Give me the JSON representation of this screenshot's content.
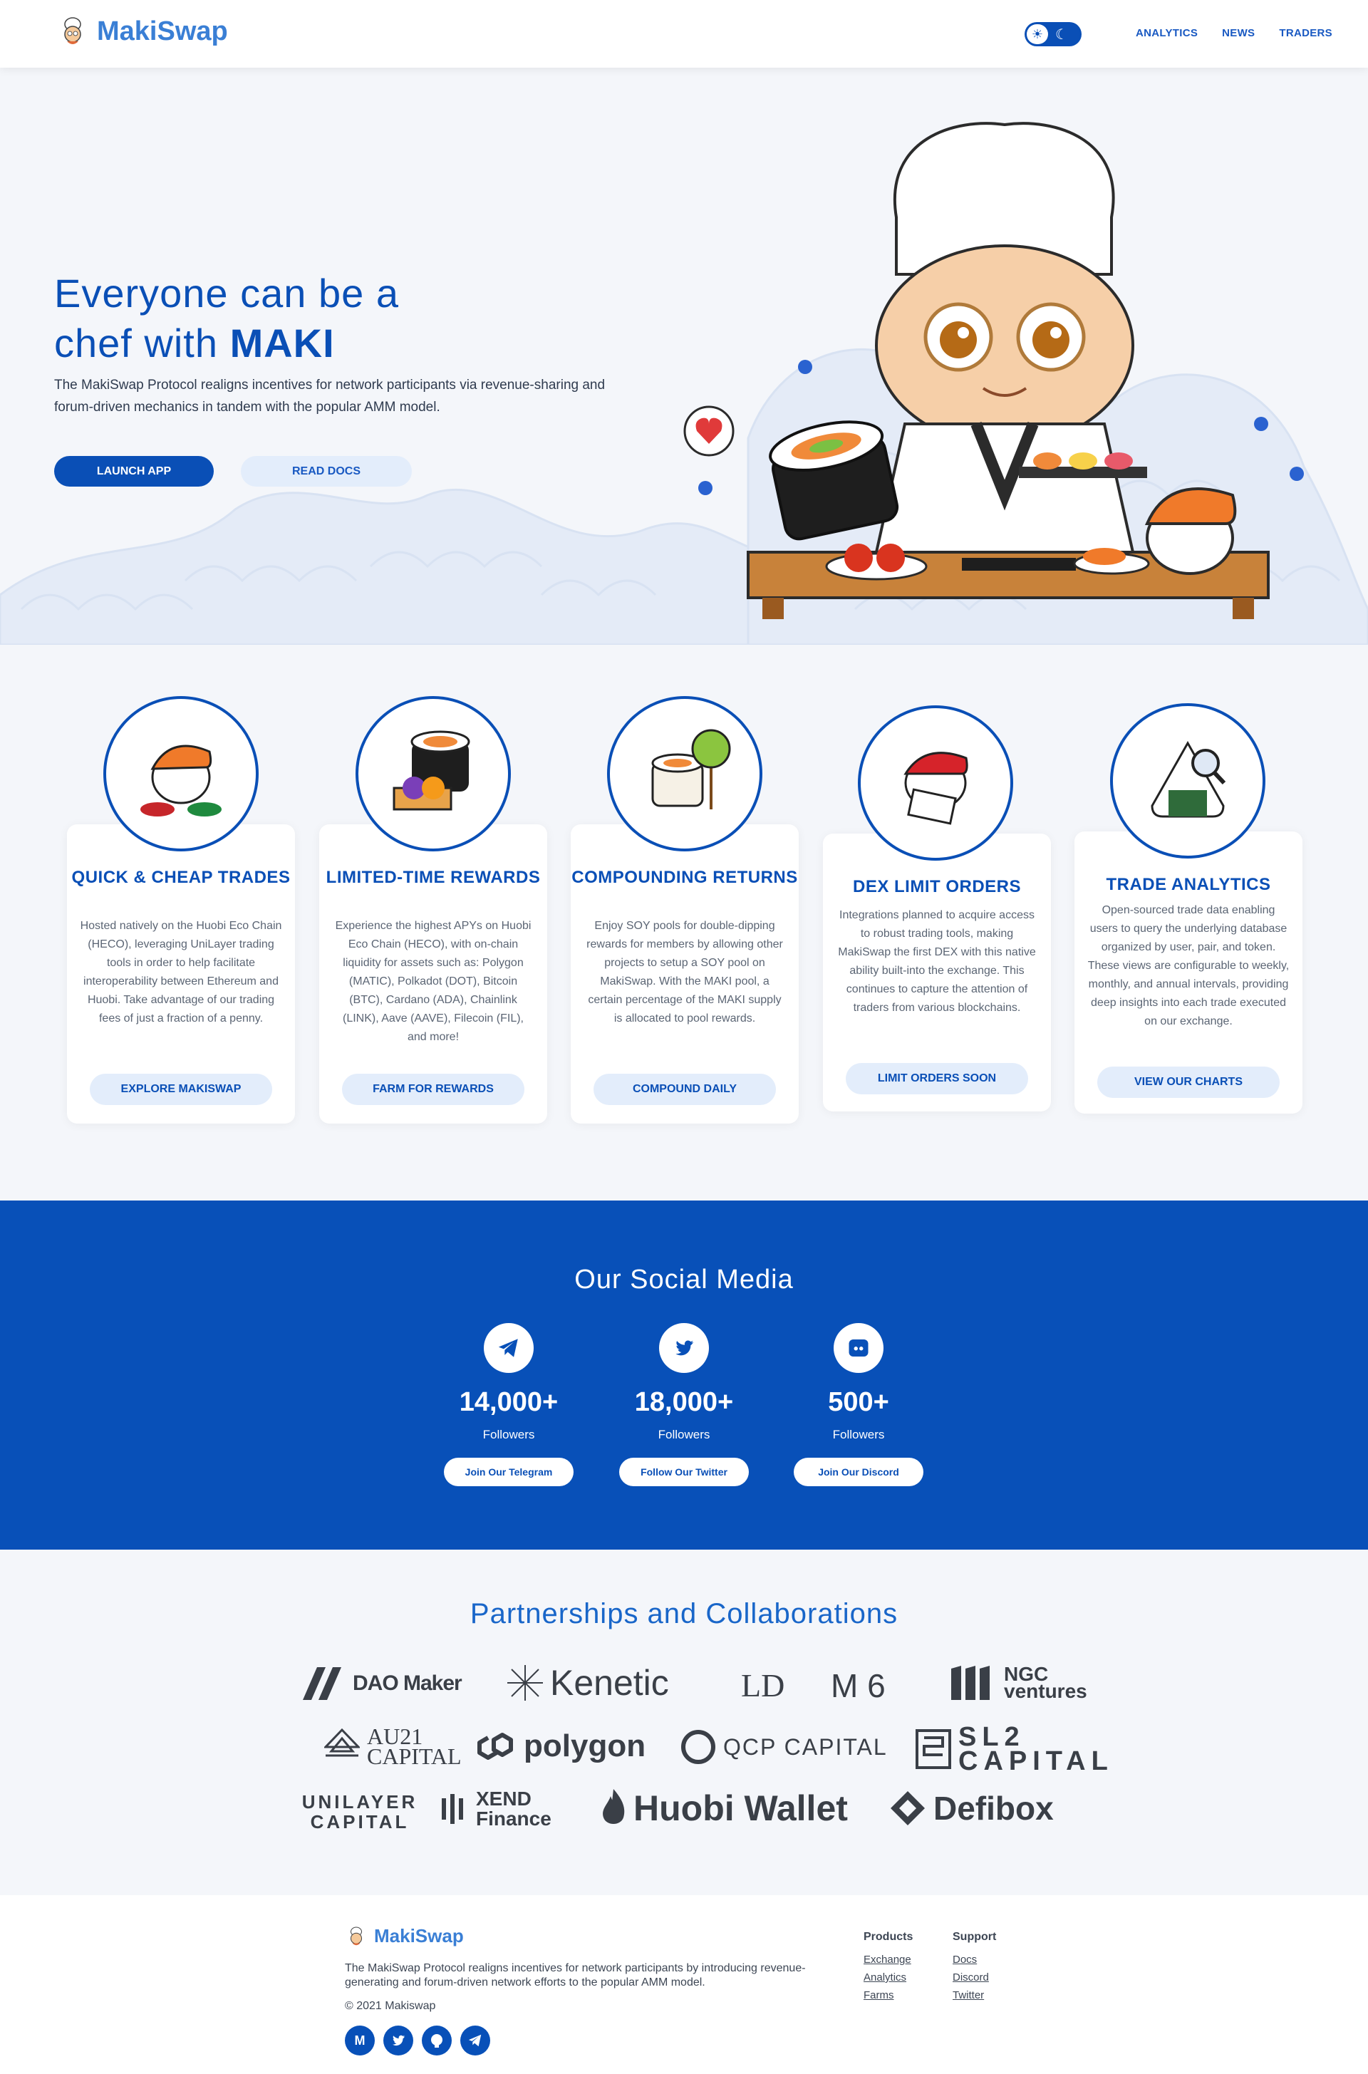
{
  "nav": {
    "brand": "MakiSwap",
    "links": [
      "ANALYTICS",
      "NEWS",
      "TRADERS"
    ]
  },
  "hero": {
    "title_line1": "Everyone can be a",
    "title_line2_prefix": "chef with ",
    "title_line2_bold": "MAKI",
    "description": "The MakiSwap Protocol realigns incentives for network participants via revenue-sharing and forum-driven mechanics in tandem with the popular AMM model.",
    "primary_button": "LAUNCH APP",
    "secondary_button": "READ DOCS"
  },
  "features": [
    {
      "title": "QUICK & CHEAP TRADES",
      "button": "EXPLORE MAKISWAP",
      "body": "Hosted natively on the Huobi Eco Chain (HECO), leveraging UniLayer trading tools in order to help facilitate interoperability between Ethereum and Huobi. Take advantage of our trading fees of just a fraction of a penny."
    },
    {
      "title": "LIMITED-TIME REWARDS",
      "button": "FARM FOR REWARDS",
      "body": "Experience the highest APYs on Huobi Eco Chain (HECO), with on-chain liquidity for assets such as: Polygon (MATIC), Polkadot (DOT), Bitcoin (BTC), Cardano (ADA), Chainlink (LINK), Aave (AAVE), Filecoin (FIL), and more!"
    },
    {
      "title": "COMPOUNDING RETURNS",
      "button": "COMPOUND DAILY",
      "body": "Enjoy SOY pools for double-dipping rewards for members by allowing other projects to setup a SOY pool on MakiSwap. With the MAKI pool, a certain percentage of the MAKI supply is allocated to pool rewards."
    },
    {
      "title": "DEX LIMIT ORDERS",
      "button": "LIMIT ORDERS SOON",
      "body": "Integrations planned to acquire access to robust trading tools, making MakiSwap the first DEX with this native ability built-into the exchange. This continues to capture the attention of traders from various blockchains."
    },
    {
      "title": "TRADE ANALYTICS",
      "button": "VIEW OUR CHARTS",
      "body": "Open-sourced trade data enabling users to query the underlying database organized by user, pair, and token. These views are configurable to weekly, monthly, and annual intervals, providing deep insights into each trade executed on our exchange."
    }
  ],
  "social": {
    "title": "Our Social Media",
    "channels": [
      {
        "icon": "telegram-icon",
        "count": "14,000+",
        "label": "Followers",
        "button": "Join Our Telegram"
      },
      {
        "icon": "twitter-icon",
        "count": "18,000+",
        "label": "Followers",
        "button": "Follow Our Twitter"
      },
      {
        "icon": "discord-icon",
        "count": "500+",
        "label": "Followers",
        "button": "Join Our Discord"
      }
    ]
  },
  "partners": {
    "title": "Partnerships and Collaborations",
    "logos": [
      "DAO Maker",
      "Kenetic",
      "LD",
      "M 6",
      "NGC ventures",
      "AU21 CAPITAL",
      "polygon",
      "QCP CAPITAL",
      "SL2 CAPITAL",
      "UNILAYER CAPITAL",
      "XEND Finance",
      "Huobi Wallet",
      "Defibox"
    ]
  },
  "footer": {
    "brand": "MakiSwap",
    "description": "The MakiSwap Protocol realigns incentives for network participants by introducing revenue-generating and forum-driven network efforts to the popular AMM model.",
    "copyright": "© 2021 Makiswap",
    "products_title": "Products",
    "products": [
      "Exchange",
      "Analytics",
      "Farms"
    ],
    "support_title": "Support",
    "support": [
      "Docs",
      "Discord",
      "Twitter"
    ]
  },
  "colors": {
    "primary": "#0a4fb6",
    "brand_light": "#3a7fd5",
    "soft_button": "#e3edfb",
    "social_bg": "#0850b8"
  }
}
